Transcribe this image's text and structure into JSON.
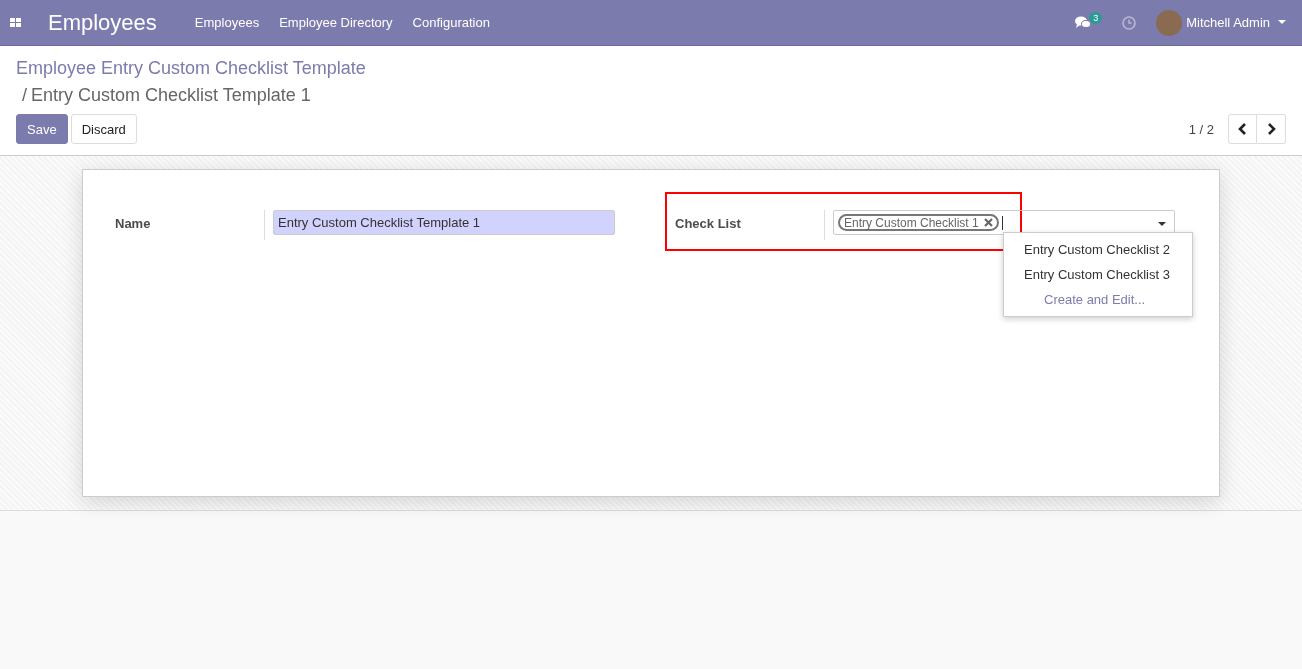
{
  "navbar": {
    "app_title": "Employees",
    "menu": [
      "Employees",
      "Employee Directory",
      "Configuration"
    ],
    "message_count": "3",
    "user_name": "Mitchell Admin"
  },
  "breadcrumb": {
    "parent": "Employee Entry Custom Checklist Template",
    "separator": "/",
    "current": "Entry Custom Checklist Template 1"
  },
  "buttons": [
    {
      "label": "Save",
      "kind": "primary"
    },
    {
      "label": "Discard",
      "kind": "secondary"
    }
  ],
  "pager": {
    "value": "1 / 2"
  },
  "name_field": {
    "label": "Name",
    "value": "Entry Custom Checklist Template 1"
  },
  "checklist_field": {
    "label": "Check List",
    "tags": [
      "Entry Custom Checklist 1"
    ],
    "highlighted": true
  },
  "dropdown": {
    "options": [
      {
        "label": "Entry Custom Checklist 2",
        "kind": "option"
      },
      {
        "label": "Entry Custom Checklist 3",
        "kind": "option"
      },
      {
        "label": "Create and Edit...",
        "kind": "action"
      }
    ]
  }
}
